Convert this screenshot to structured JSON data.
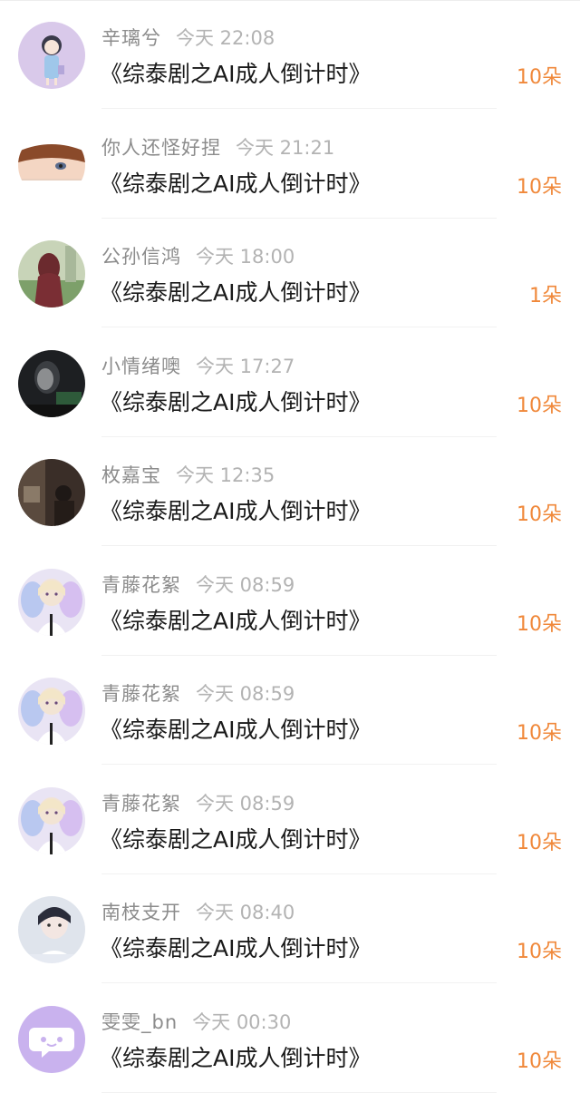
{
  "records": [
    {
      "name": "辛璃兮",
      "time": "今天 22:08",
      "title": "《综泰剧之AI成人倒计时》",
      "count": "10朵",
      "avatar_icon": "anime-girl-avatar-icon"
    },
    {
      "name": "你人还怪好捏",
      "time": "今天 21:21",
      "title": "《综泰剧之AI成人倒计时》",
      "count": "10朵",
      "avatar_icon": "anime-boy-face-avatar-icon"
    },
    {
      "name": "公孙信鸿",
      "time": "今天 18:00",
      "title": "《综泰剧之AI成人倒计时》",
      "count": "1朵",
      "avatar_icon": "girl-photo-avatar-icon"
    },
    {
      "name": "小情绪噢",
      "time": "今天 17:27",
      "title": "《综泰剧之AI成人倒计时》",
      "count": "10朵",
      "avatar_icon": "dark-portrait-avatar-icon"
    },
    {
      "name": "枚嘉宝",
      "time": "今天 12:35",
      "title": "《综泰剧之AI成人倒计时》",
      "count": "10朵",
      "avatar_icon": "night-room-avatar-icon"
    },
    {
      "name": "青藤花絮",
      "time": "今天 08:59",
      "title": "《综泰剧之AI成人倒计时》",
      "count": "10朵",
      "avatar_icon": "fairy-wings-avatar-icon"
    },
    {
      "name": "青藤花絮",
      "time": "今天 08:59",
      "title": "《综泰剧之AI成人倒计时》",
      "count": "10朵",
      "avatar_icon": "fairy-wings-avatar-icon"
    },
    {
      "name": "青藤花絮",
      "time": "今天 08:59",
      "title": "《综泰剧之AI成人倒计时》",
      "count": "10朵",
      "avatar_icon": "fairy-wings-avatar-icon"
    },
    {
      "name": "南枝支开",
      "time": "今天 08:40",
      "title": "《综泰剧之AI成人倒计时》",
      "count": "10朵",
      "avatar_icon": "anime-boy-portrait-avatar-icon"
    },
    {
      "name": "雯雯_bn",
      "time": "今天 00:30",
      "title": "《综泰剧之AI成人倒计时》",
      "count": "10朵",
      "avatar_icon": "default-chat-bubble-avatar-icon"
    }
  ],
  "colors": {
    "accent_count": "#f0883a",
    "name_text": "#8c8c8c",
    "time_text": "#b3b3b3",
    "title_text": "#1a1a1a",
    "divider": "#f1f1f1"
  }
}
